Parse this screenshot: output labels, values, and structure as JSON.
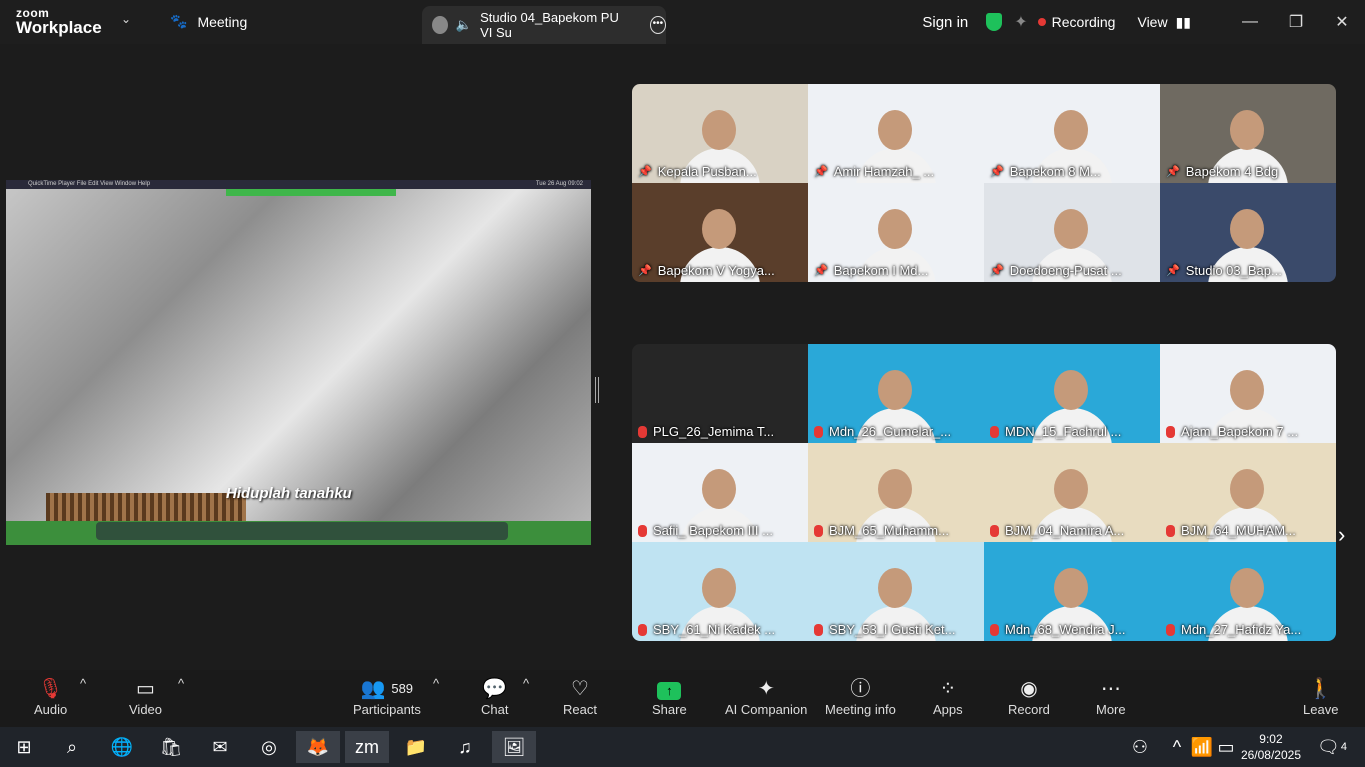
{
  "app": {
    "logo_top": "zoom",
    "logo_bottom": "Workplace"
  },
  "tabs": {
    "meeting": "Meeting",
    "active": "Studio 04_Bapekom PU VI Su"
  },
  "header": {
    "sign_in": "Sign in",
    "recording": "Recording",
    "view": "View"
  },
  "shared_screen": {
    "subtitle": "Hiduplah tanahku",
    "menubar": "QuickTime Player   File   Edit   View   Window   Help",
    "top_right_clock": "Tue 26 Aug 09:02"
  },
  "grid_top": [
    {
      "name": "Kepala Pusban...",
      "bg": "#d9d2c4",
      "icon": "pin"
    },
    {
      "name": "Amir Hamzah_ ...",
      "bg": "#eef1f5",
      "icon": "pin"
    },
    {
      "name": "Bapekom 8 M...",
      "bg": "#eef1f5",
      "icon": "pin"
    },
    {
      "name": "Bapekom 4 Bdg",
      "bg": "#6f6a61",
      "icon": "pin"
    },
    {
      "name": "Bapekom V Yogya...",
      "bg": "#5a3e2b",
      "icon": "pin"
    },
    {
      "name": "Bapekom I Md...",
      "bg": "#eef1f5",
      "icon": "pin"
    },
    {
      "name": "Doedoeng-Pusat ...",
      "bg": "#dfe3e8",
      "icon": "pin"
    },
    {
      "name": "Studio 03_Bap...",
      "bg": "#3a4a6a",
      "icon": "pin"
    }
  ],
  "grid_bottom": [
    {
      "name": "PLG_26_Jemima T...",
      "bg": "#262626",
      "icon": "mic-off"
    },
    {
      "name": "Mdn_26_Gumelar_...",
      "bg": "#2aa8d8",
      "icon": "mic-off"
    },
    {
      "name": "MDN_15_Fachrul ...",
      "bg": "#2aa8d8",
      "icon": "mic-off"
    },
    {
      "name": "Ajam_Bapekom 7 ...",
      "bg": "#eef1f5",
      "icon": "mic-off"
    },
    {
      "name": "Safii_ Bapekom III ...",
      "bg": "#eef1f5",
      "icon": "mic-off"
    },
    {
      "name": "BJM_65_Muhamm...",
      "bg": "#e8dcc0",
      "icon": "mic-off"
    },
    {
      "name": "BJM_04_Namira A...",
      "bg": "#e8dcc0",
      "icon": "mic-off"
    },
    {
      "name": "BJM_64_MUHAM...",
      "bg": "#e8dcc0",
      "icon": "mic-off"
    },
    {
      "name": "SBY_61_Ni Kadek ...",
      "bg": "#bfe3f2",
      "icon": "mic-off"
    },
    {
      "name": "SBY_53_I Gusti Ket...",
      "bg": "#bfe3f2",
      "icon": "mic-off"
    },
    {
      "name": "Mdn_68_Wendra J...",
      "bg": "#2aa8d8",
      "icon": "mic-off"
    },
    {
      "name": "Mdn_27_Hafidz Ya...",
      "bg": "#2aa8d8",
      "icon": "mic-off"
    }
  ],
  "toolbar": {
    "audio": "Audio",
    "video": "Video",
    "participants": "Participants",
    "participant_count": "589",
    "chat": "Chat",
    "react": "React",
    "share": "Share",
    "ai_companion": "AI Companion",
    "meeting_info": "Meeting info",
    "apps": "Apps",
    "record": "Record",
    "more": "More",
    "leave": "Leave"
  },
  "taskbar": {
    "time": "9:02",
    "date": "26/08/2025",
    "notifications": "4"
  },
  "colors": {
    "accent_green": "#1ec15b",
    "record_red": "#e53935"
  }
}
